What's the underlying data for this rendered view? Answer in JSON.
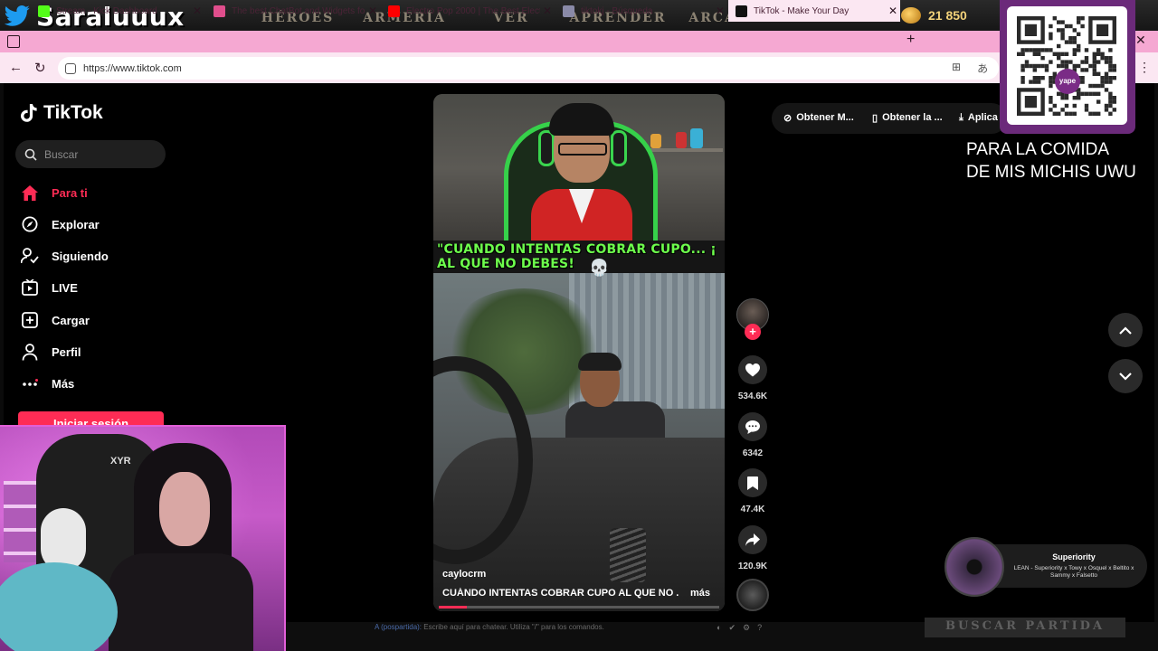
{
  "stream": {
    "name": "Saraluuux",
    "game_menu": [
      "HÉROES",
      "ARMERÍA",
      "VER",
      "APRENDER",
      "ARCADE"
    ],
    "coins": "21 850"
  },
  "browser": {
    "tabs": [
      {
        "label": "Stream - Kick Dashboard",
        "favicon_color": "#53fc18",
        "active": false
      },
      {
        "label": "The best ChatBot and Widgets fo",
        "favicon_color": "#e04e8c",
        "active": false
      },
      {
        "label": "Electro Pop 2000 | The Best Electr",
        "favicon_color": "#ff0000",
        "active": false
      },
      {
        "label": "tiktokj - Búsqueda",
        "favicon_color": "#8a8aa8",
        "active": false
      },
      {
        "label": "TikTok - Make Your Day",
        "favicon_color": "#111111",
        "active": true
      }
    ],
    "url": "https://www.tiktok.com",
    "new_tab": "+"
  },
  "tiktok": {
    "logo": "TikTok",
    "search_placeholder": "Buscar",
    "nav": [
      {
        "label": "Para ti",
        "icon": "home-icon",
        "active": true
      },
      {
        "label": "Explorar",
        "icon": "compass-icon",
        "active": false
      },
      {
        "label": "Siguiendo",
        "icon": "following-icon",
        "active": false
      },
      {
        "label": "LIVE",
        "icon": "live-icon",
        "active": false
      },
      {
        "label": "Cargar",
        "icon": "upload-icon",
        "active": false
      },
      {
        "label": "Perfil",
        "icon": "profile-icon",
        "active": false
      },
      {
        "label": "Más",
        "icon": "more-icon",
        "active": false
      }
    ],
    "login_label": "Iniciar sesión",
    "top_buttons": [
      "Obtener M...",
      "Obtener la ...",
      "Aplica"
    ],
    "video": {
      "caption_line1": "\"CUANDO INTENTAS COBRAR CUPO... ¡",
      "caption_line2": "AL QUE NO DEBES!",
      "author": "caylocrm",
      "description": "CUÁNDO INTENTAS COBRAR CUPO AL QUE NO ...",
      "more_label": "más",
      "progress": 0.1
    },
    "actions": {
      "follow": "+",
      "likes": "534.6K",
      "comments": "6342",
      "saves": "47.4K",
      "shares": "120.9K"
    },
    "accent": "#fe2c55"
  },
  "overlay": {
    "donation_text": "PARA LA COMIDA\nDE MIS MICHIS UWU",
    "qr_badge": "yape",
    "cam_label": "XYR",
    "chat_prefix": "A (pospartida):",
    "chat_placeholder": "Escribe aquí para chatear. Utiliza \"/\" para los comandos.",
    "find_match": "BUSCAR PARTIDA",
    "now_playing_title": "Superiority",
    "now_playing_artists": "LEAN - Superiority x Towy x Osquel x Beltito x Sammy x Falsetto"
  }
}
